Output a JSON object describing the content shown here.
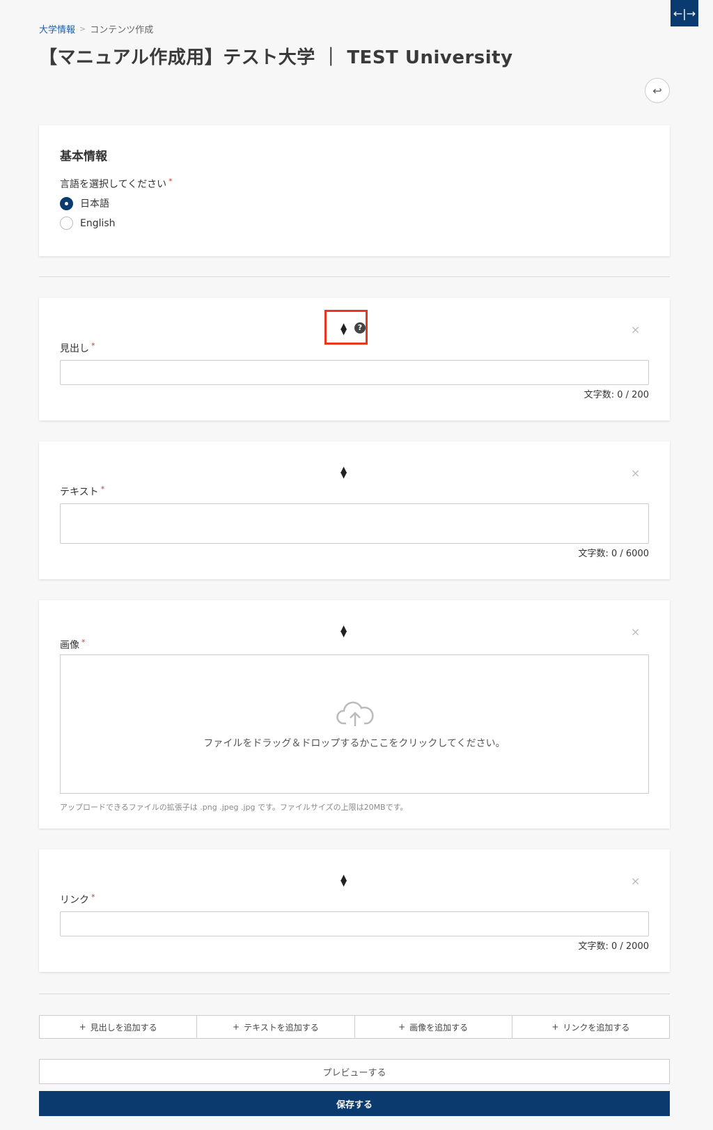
{
  "breadcrumb": {
    "home": "大学情報",
    "separator": ">",
    "current": "コンテンツ作成"
  },
  "page_title": "【マニュアル作成用】テスト大学 ｜ TEST University",
  "basic_info": {
    "title": "基本情報",
    "language_label": "言語を選択してください",
    "required_mark": "*",
    "options": [
      {
        "label": "日本語",
        "checked": true
      },
      {
        "label": "English",
        "checked": false
      }
    ]
  },
  "blocks": {
    "heading": {
      "label": "見出し",
      "required_mark": "*",
      "counter": "文字数: 0 / 200",
      "value": ""
    },
    "text": {
      "label": "テキスト",
      "required_mark": "*",
      "counter": "文字数: 0 / 6000",
      "value": ""
    },
    "image": {
      "label": "画像",
      "required_mark": "*",
      "drop_text": "ファイルをドラッグ＆ドロップするかここをクリックしてください。",
      "hint": "アップロードできるファイルの拡張子は .png .jpeg .jpg です。ファイルサイズの上限は20MBです。"
    },
    "link": {
      "label": "リンク",
      "required_mark": "*",
      "counter": "文字数: 0 / 2000",
      "value": ""
    }
  },
  "icons": {
    "sort": "sort-icon",
    "help": "?",
    "close": "×",
    "back": "↩",
    "expand": "←|→",
    "plus": "+"
  },
  "actions": {
    "add_heading": "見出しを追加する",
    "add_text": "テキストを追加する",
    "add_image": "画像を追加する",
    "add_link": "リンクを追加する",
    "preview": "プレビューする",
    "save": "保存する"
  },
  "colors": {
    "primary": "#0b3a6e",
    "highlight": "#e8371c",
    "required": "#d33"
  }
}
